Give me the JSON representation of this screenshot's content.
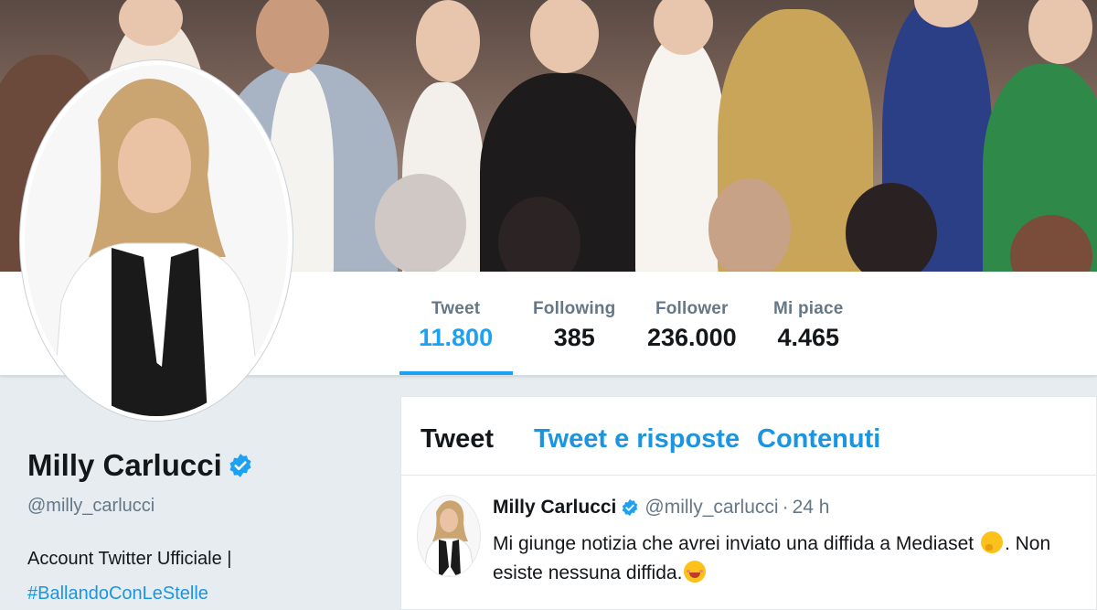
{
  "profile": {
    "name": "Milly Carlucci",
    "handle": "@milly_carlucci",
    "bio_line1": "Account Twitter Ufficiale |",
    "bio_hashtag": "#BallandoConLeStelle",
    "verified_icon": "verified-badge-icon"
  },
  "stats": [
    {
      "label": "Tweet",
      "value": "11.800"
    },
    {
      "label": "Following",
      "value": "385"
    },
    {
      "label": "Follower",
      "value": "236.000"
    },
    {
      "label": "Mi piace",
      "value": "4.465"
    }
  ],
  "tabs": [
    {
      "label": "Tweet"
    },
    {
      "label": "Tweet e risposte"
    },
    {
      "label": "Contenuti"
    }
  ],
  "tweet": {
    "author": "Milly Carlucci",
    "handle": "@milly_carlucci",
    "separator": "·",
    "time": "24 h",
    "text_part1": "Mi giunge notizia che avrei inviato  una diffida a Mediaset ",
    "text_part2": ". Non esiste nessuna diffida.",
    "emoji1": "thinking-face-icon",
    "emoji2": "smiling-face-icon"
  },
  "colors": {
    "accent": "#1da1f2",
    "link": "#1b95e0",
    "background": "#e6ecf0",
    "text": "#14171a",
    "muted": "#657786"
  }
}
